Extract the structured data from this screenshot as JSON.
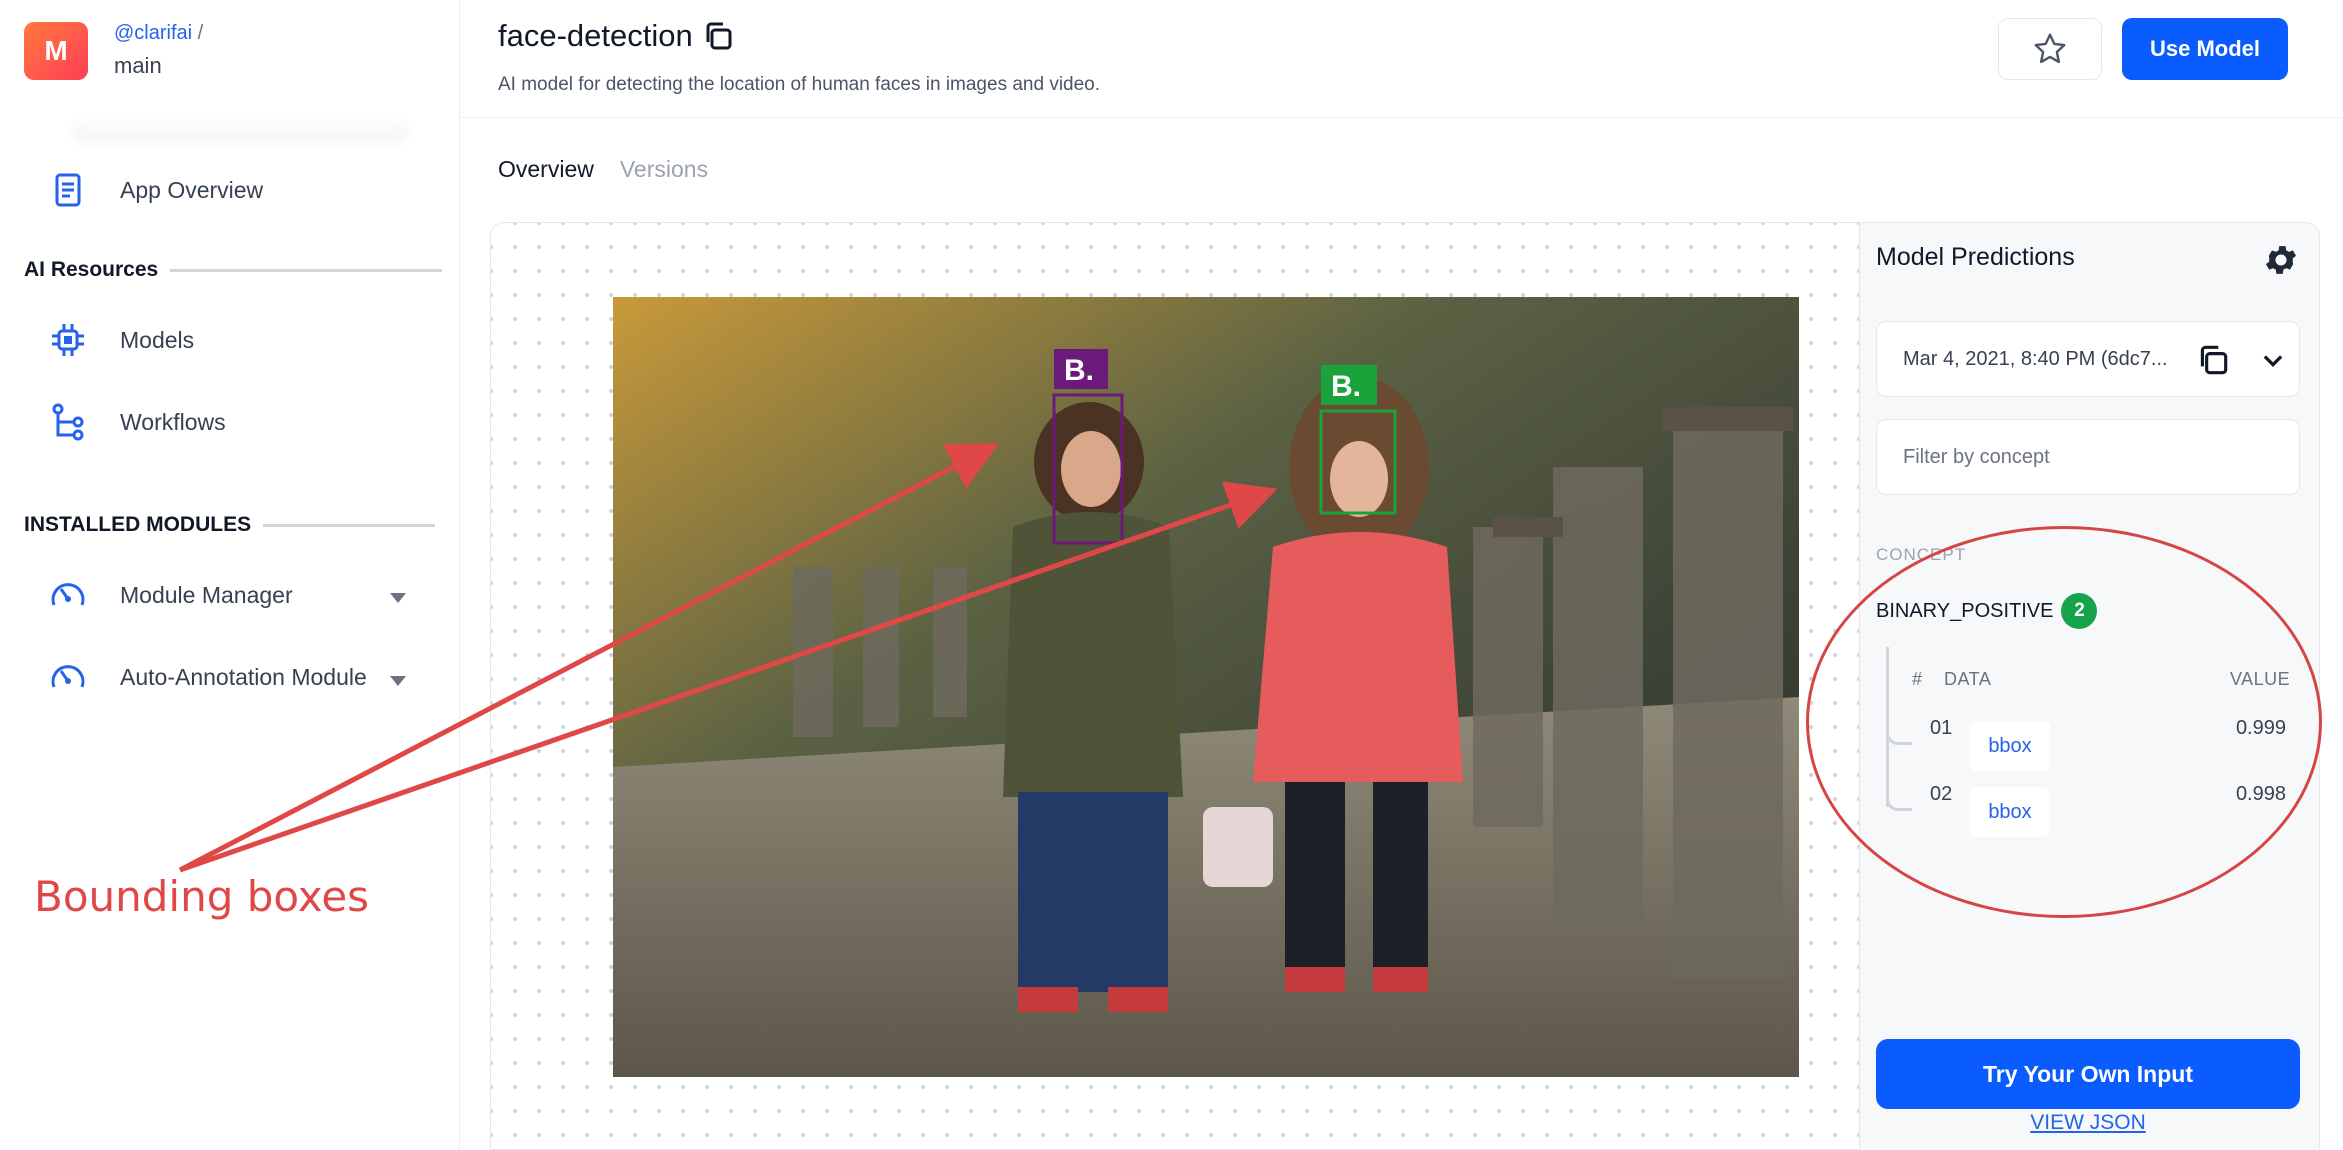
{
  "app": {
    "avatar_letter": "M",
    "owner": "@clarifai",
    "slash": "/",
    "name": "main"
  },
  "sidebar": {
    "overview": "App Overview",
    "ai_resources_title": "AI Resources",
    "models": "Models",
    "workflows": "Workflows",
    "installed_title": "INSTALLED MODULES",
    "module_manager": "Module Manager",
    "auto_annotation": "Auto-Annotation Module"
  },
  "annotation": {
    "label": "Bounding boxes"
  },
  "header": {
    "title": "face-detection",
    "description": "AI model for detecting the location of human faces in images and video.",
    "use_model": "Use Model"
  },
  "tabs": [
    {
      "label": "Overview"
    },
    {
      "label": "Versions"
    }
  ],
  "image": {
    "box_labels": [
      "B.",
      "B."
    ]
  },
  "predictions": {
    "title": "Model Predictions",
    "version": "Mar 4, 2021, 8:40 PM (6dc7...",
    "filter_placeholder": "Filter by concept",
    "concept_header": "CONCEPT",
    "concept": "BINARY_POSITIVE",
    "concept_count": "2",
    "columns": {
      "num": "#",
      "data": "DATA",
      "value": "VALUE"
    },
    "rows": [
      {
        "num": "01",
        "data": "bbox",
        "value": "0.999"
      },
      {
        "num": "02",
        "data": "bbox",
        "value": "0.998"
      }
    ],
    "try_button": "Try Your Own Input",
    "json_link": "VIEW JSON"
  },
  "colors": {
    "accent": "#0a5cff",
    "badge_green": "#16a34a",
    "annotation_red": "#d64545",
    "box_purple": "#6b1a7c",
    "box_green": "#1aa33a"
  }
}
